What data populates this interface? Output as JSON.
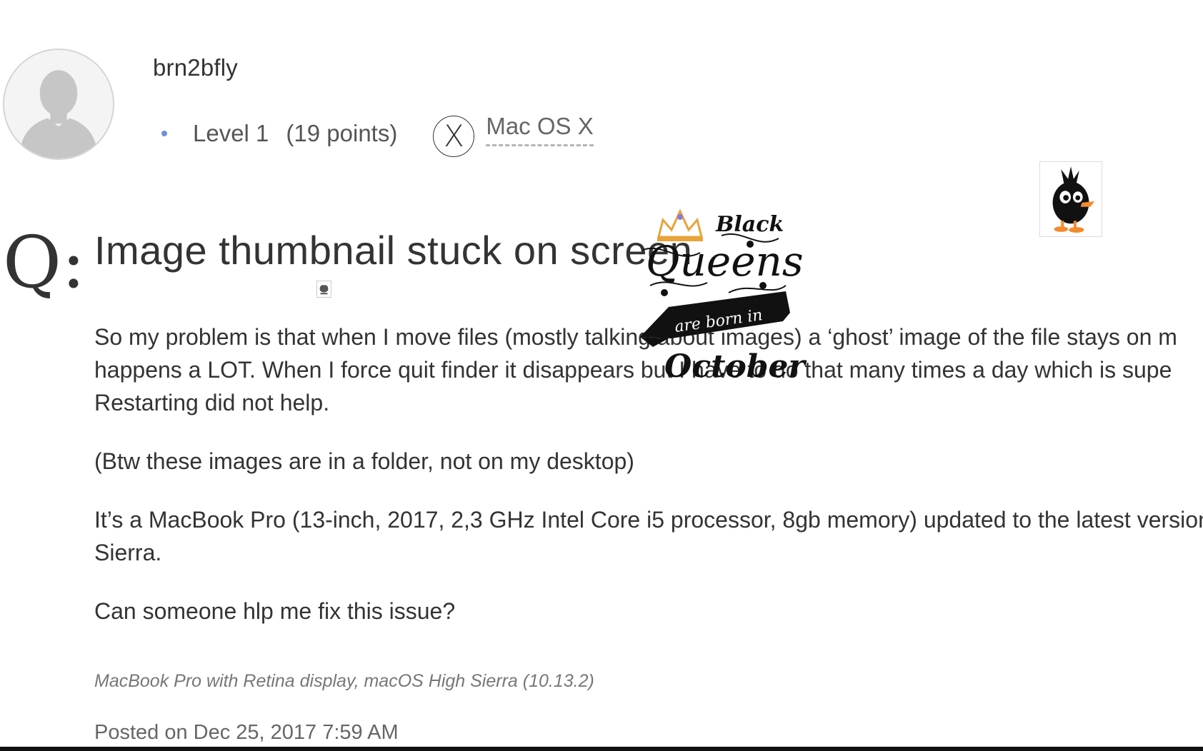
{
  "author": {
    "username": "brn2bfly",
    "level": "Level 1",
    "points": "(19 points)",
    "os_badge_symbol": "X",
    "os_link": "Mac OS X"
  },
  "question": {
    "marker": "Q:",
    "title": "Image thumbnail stuck on screen",
    "body": [
      [
        "So my problem is that when I move files (mostly talking about images) a ‘ghost’ image of the file stays on m",
        "happens a LOT. When I force quit finder it disappears but I have to do that many times a day which is supe",
        "Restarting did not help."
      ],
      [
        "(Btw these images are in a folder, not on my desktop)"
      ],
      [
        "It’s a MacBook Pro (13-inch, 2017, 2,3 GHz Intel Core i5 processor, 8gb memory) updated to the latest version",
        "Sierra."
      ],
      [
        "Can someone hlp me fix this issue?"
      ]
    ],
    "product": "MacBook Pro with Retina display, macOS High Sierra (10.13.2)",
    "posted": "Posted on Dec 25, 2017 7:59 AM"
  },
  "ghost_image": {
    "line1": "Black",
    "line2": "Queens",
    "line3": "are born in",
    "line4": "October"
  },
  "colors": {
    "accent_dot": "#6f8fd6",
    "text": "#333333",
    "muted": "#777777"
  },
  "icons": {
    "avatar": "default-user-silhouette-icon",
    "os_badge": "mac-os-x-badge-icon",
    "duck": "black-duck-cartoon-image",
    "ghost": "black-queens-october-graphic"
  }
}
